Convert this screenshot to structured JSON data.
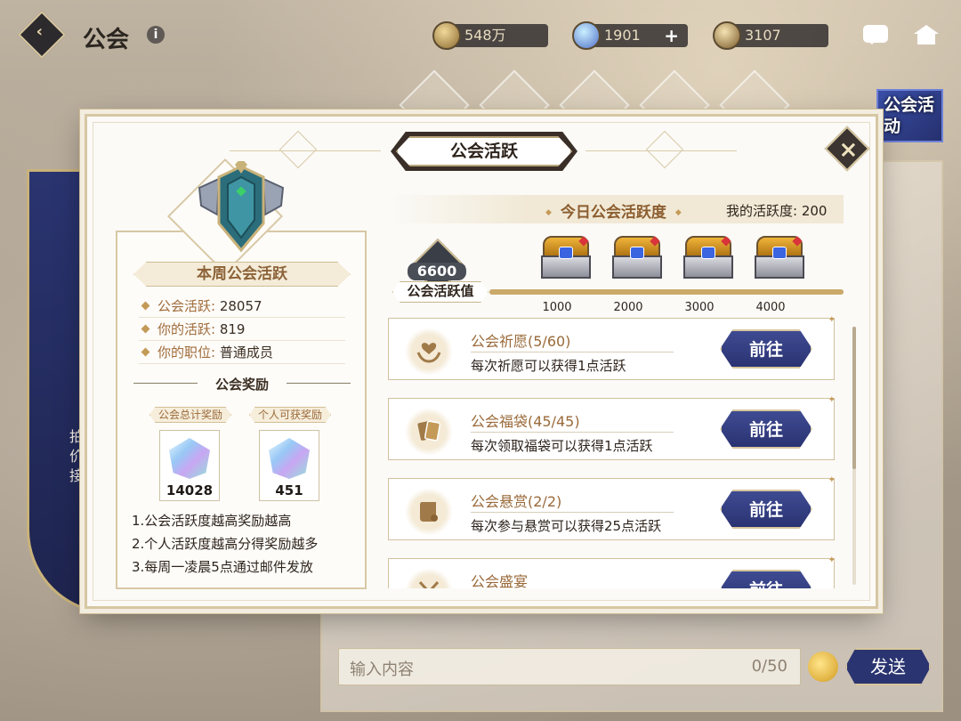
{
  "header": {
    "title": "公会",
    "currencies": [
      {
        "icon": "gold-coin-icon",
        "value": "548万"
      },
      {
        "icon": "gem-icon",
        "value": "1901"
      },
      {
        "icon": "guild-coin-icon",
        "value": "3107"
      }
    ]
  },
  "background": {
    "event_label": "公会活动",
    "banner_text": "拍价接",
    "chat": {
      "placeholder": "输入内容",
      "counter": "0/50",
      "send_label": "发送"
    }
  },
  "modal": {
    "title": "公会活跃",
    "week_panel": {
      "title": "本周公会活跃",
      "stats": [
        {
          "label": "公会活跃:",
          "value": "28057"
        },
        {
          "label": "你的活跃:",
          "value": "819"
        },
        {
          "label": "你的职位:",
          "value": "普通成员"
        }
      ],
      "rewards_title": "公会奖励",
      "rewards": [
        {
          "tag": "公会总计奖励",
          "qty": "14028",
          "icon": "crystal-icon"
        },
        {
          "tag": "个人可获奖励",
          "qty": "451",
          "icon": "crystal-icon"
        }
      ],
      "rules": [
        "1.公会活跃度越高奖励越高",
        "2.个人活跃度越高分得奖励越多",
        "3.每周一凌晨5点通过邮件发放"
      ]
    },
    "today": {
      "title": "今日公会活跃度",
      "my_activity": "我的活跃度: 200",
      "total_value": "6600",
      "progress_label": "公会活跃值",
      "progress_fraction": 1.0,
      "milestones": [
        "1000",
        "2000",
        "3000",
        "4000"
      ]
    },
    "tasks": [
      {
        "name": "公会祈愿(5/60)",
        "desc": "每次祈愿可以获得1点活跃",
        "button": "前往",
        "icon": "heart-hands-icon"
      },
      {
        "name": "公会福袋(45/45)",
        "desc": "每次领取福袋可以获得1点活跃",
        "button": "前往",
        "icon": "cards-icon"
      },
      {
        "name": "公会悬赏(2/2)",
        "desc": "每次参与悬赏可以获得25点活跃",
        "button": "前往",
        "icon": "scroll-icon"
      },
      {
        "name": "公会盛宴",
        "desc": "",
        "button": "前往",
        "icon": "fork-knife-icon"
      }
    ]
  }
}
